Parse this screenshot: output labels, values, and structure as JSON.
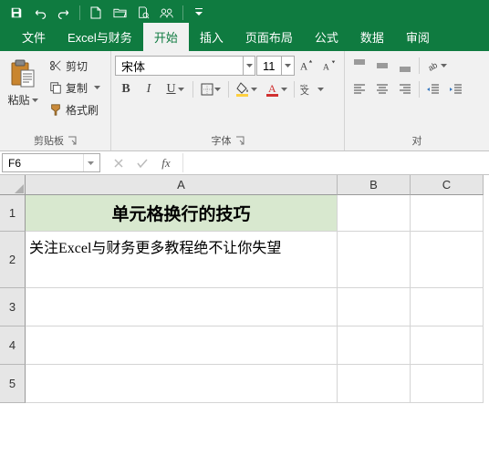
{
  "qat": {
    "save": "save",
    "undo": "undo",
    "redo": "redo"
  },
  "tabs": {
    "file": "文件",
    "custom": "Excel与财务",
    "home": "开始",
    "insert": "插入",
    "layout": "页面布局",
    "formulas": "公式",
    "data": "数据",
    "review": "审阅"
  },
  "ribbon": {
    "paste": "粘贴",
    "cut": "剪切",
    "copy": "复制",
    "format_painter": "格式刷",
    "clipboard_group": "剪贴板",
    "font_name": "宋体",
    "font_size": "11",
    "font_group": "字体",
    "align_group": "对"
  },
  "namebox": "F6",
  "cols": {
    "A": "A",
    "B": "B",
    "C": "C"
  },
  "rows": {
    "r1": "1",
    "r2": "2",
    "r3": "3",
    "r4": "4",
    "r5": "5"
  },
  "cells": {
    "A1": "单元格换行的技巧",
    "A2": "关注Excel与财务更多教程绝不让你失望"
  },
  "colors": {
    "font_color": "#d03030",
    "fill_color": "#ffd040"
  }
}
